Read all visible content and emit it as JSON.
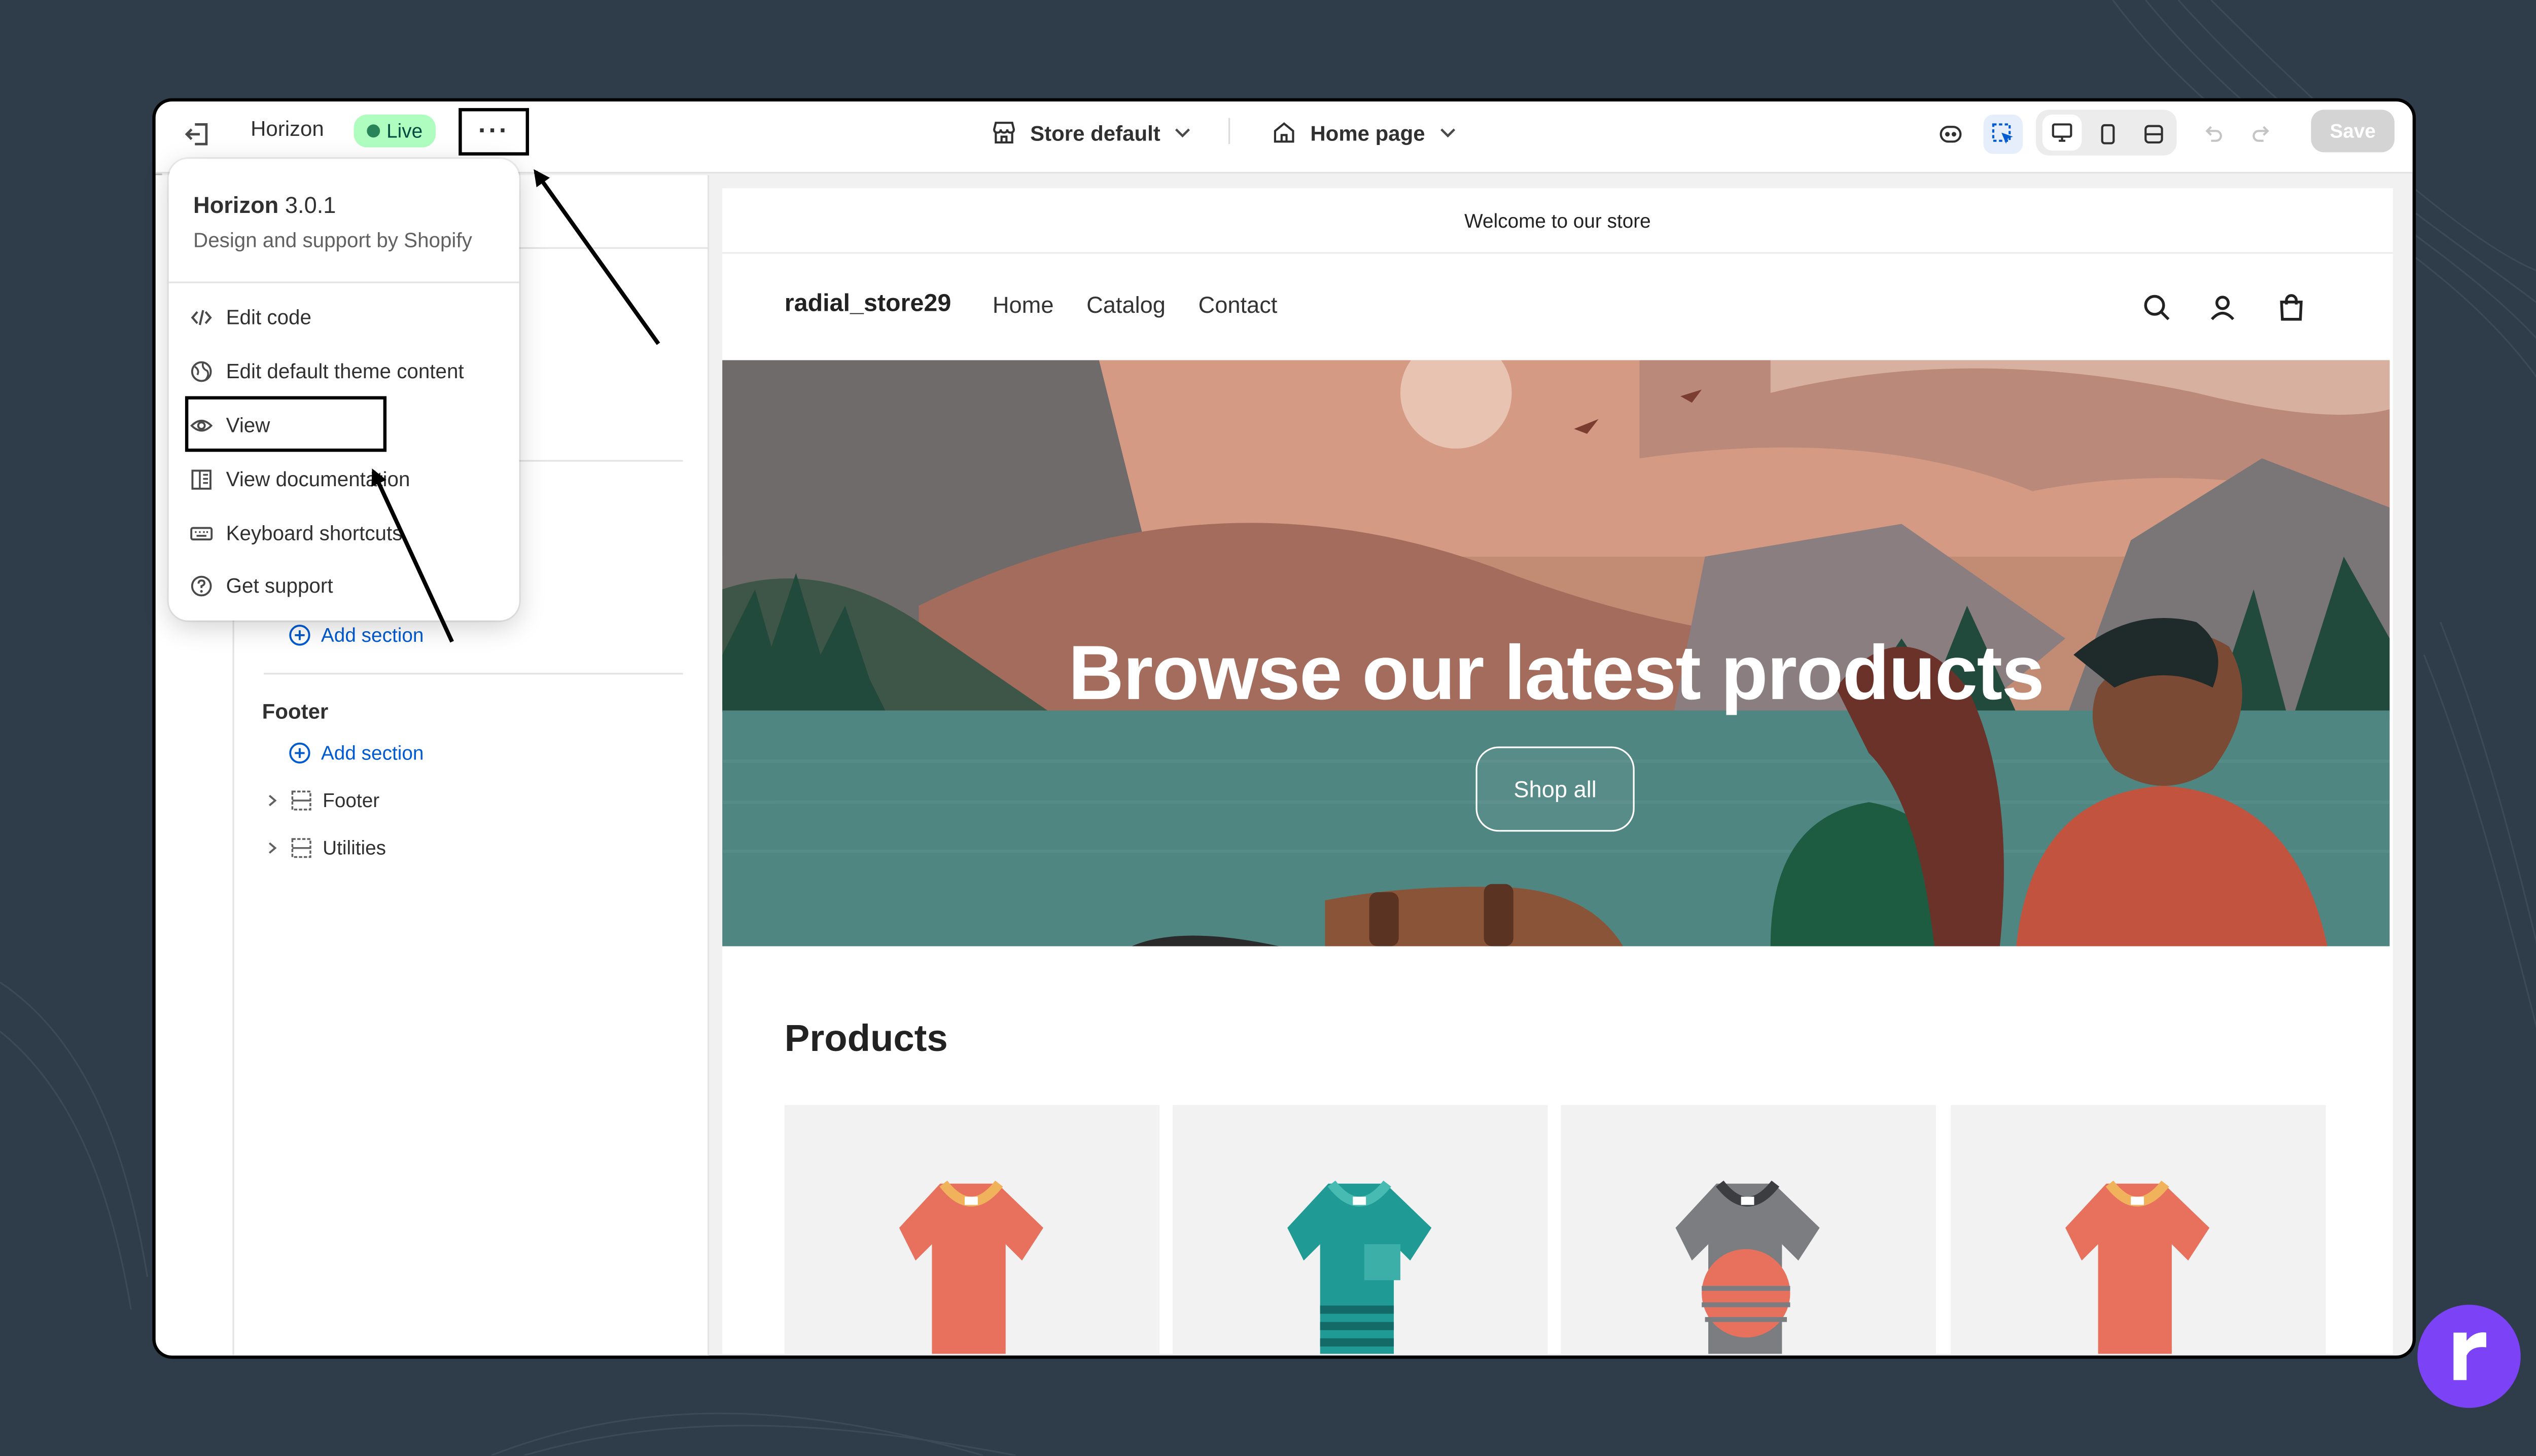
{
  "topbar": {
    "theme_name": "Horizon",
    "live_badge": "Live",
    "more_label": "···",
    "store_selector": "Store default",
    "page_selector": "Home page",
    "save_label": "Save"
  },
  "menu": {
    "title": "Horizon",
    "version": "3.0.1",
    "subtitle": "Design and support by Shopify",
    "items": [
      {
        "label": "Edit code",
        "icon": "code-icon"
      },
      {
        "label": "Edit default theme content",
        "icon": "globe-icon"
      },
      {
        "label": "View",
        "icon": "eye-icon"
      },
      {
        "label": "View documentation",
        "icon": "book-icon"
      },
      {
        "label": "Keyboard shortcuts",
        "icon": "keyboard-icon"
      },
      {
        "label": "Get support",
        "icon": "question-circle-icon"
      }
    ]
  },
  "sidebar": {
    "add_section_label": "Add section",
    "footer_heading": "Footer",
    "footer_add_section": "Add section",
    "footer_items": [
      "Footer",
      "Utilities"
    ]
  },
  "preview": {
    "announcement": "Welcome to our store",
    "store_name": "radial_store29",
    "nav": [
      "Home",
      "Catalog",
      "Contact"
    ],
    "hero_title": "Browse our latest products",
    "hero_button": "Shop all",
    "products_heading": "Products"
  },
  "colors": {
    "live_bg": "#affebf",
    "link_blue": "#005bd3",
    "logo_purple": "#7b42f6",
    "background": "#2e3d49"
  }
}
